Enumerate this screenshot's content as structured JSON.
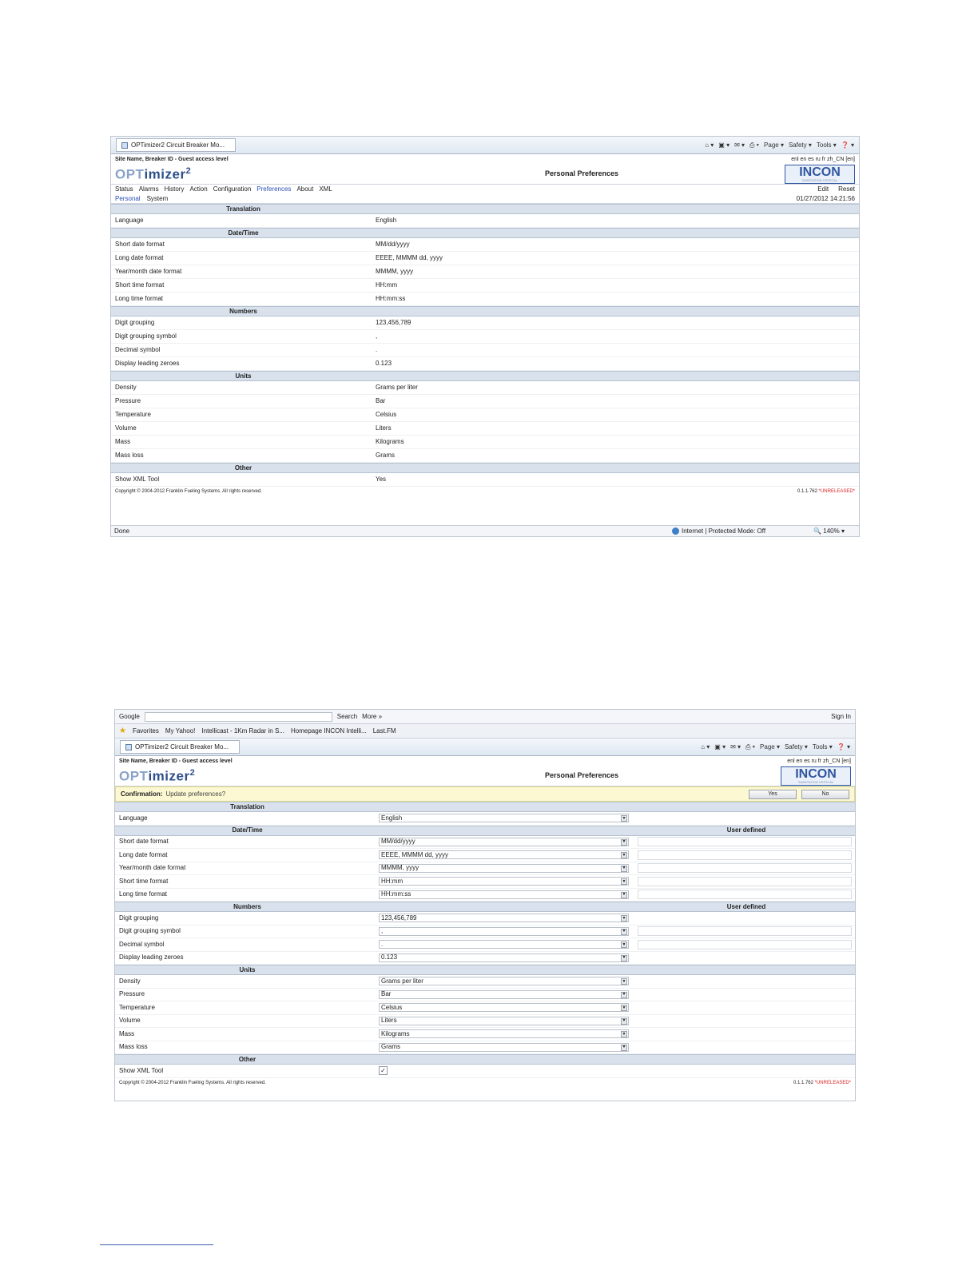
{
  "shot1": {
    "browser": {
      "tab_title": "OPTimizer2 Circuit Breaker Mo...",
      "commands": [
        "Page ▾",
        "Safety ▾",
        "Tools ▾",
        "❓ ▾"
      ]
    },
    "site_line": "Site Name, Breaker ID - Guest access level",
    "languages": "enl en es ru fr zh_CN [en]",
    "logo": {
      "light": "OPT",
      "dark": "imizer",
      "sup": "2"
    },
    "page_title": "Personal Preferences",
    "incon": {
      "brand": "INCON",
      "sub": "SUBSTATION CRITICAL"
    },
    "nav": [
      "Status",
      "Alarms",
      "History",
      "Action",
      "Configuration",
      "Preferences",
      "About",
      "XML"
    ],
    "nav_right": [
      "Edit",
      "Reset"
    ],
    "subnav": [
      "Personal",
      "System"
    ],
    "timestamp": "01/27/2012 14:21:56",
    "sections": {
      "translation": {
        "title": "Translation",
        "rows": [
          {
            "label": "Language",
            "value": "English"
          }
        ]
      },
      "datetime": {
        "title": "Date/Time",
        "rows": [
          {
            "label": "Short date format",
            "value": "MM/dd/yyyy"
          },
          {
            "label": "Long date format",
            "value": "EEEE, MMMM dd, yyyy"
          },
          {
            "label": "Year/month date format",
            "value": "MMMM, yyyy"
          },
          {
            "label": "Short time format",
            "value": "HH:mm"
          },
          {
            "label": "Long time format",
            "value": "HH:mm:ss"
          }
        ]
      },
      "numbers": {
        "title": "Numbers",
        "rows": [
          {
            "label": "Digit grouping",
            "value": "123,456,789"
          },
          {
            "label": "Digit grouping symbol",
            "value": ","
          },
          {
            "label": "Decimal symbol",
            "value": "."
          },
          {
            "label": "Display leading zeroes",
            "value": "0.123"
          }
        ]
      },
      "units": {
        "title": "Units",
        "rows": [
          {
            "label": "Density",
            "value": "Grams per liter"
          },
          {
            "label": "Pressure",
            "value": "Bar"
          },
          {
            "label": "Temperature",
            "value": "Celsius"
          },
          {
            "label": "Volume",
            "value": "Liters"
          },
          {
            "label": "Mass",
            "value": "Kilograms"
          },
          {
            "label": "Mass loss",
            "value": "Grams"
          }
        ]
      },
      "other": {
        "title": "Other",
        "rows": [
          {
            "label": "Show XML Tool",
            "value": "Yes"
          }
        ]
      }
    },
    "copyright": "Copyright © 2004-2012 Franklin Fueling Systems. All rights reserved.",
    "version": "0.1.1.762",
    "version_flag": "*UNRELEASED*",
    "status": {
      "left": "Done",
      "zone": "Internet | Protected Mode: Off",
      "zoom": "140%"
    }
  },
  "shot2": {
    "google": {
      "label": "Google",
      "search": "Search",
      "more": "More »",
      "signin": "Sign In"
    },
    "favorites": [
      "Favorites",
      "My Yahoo!",
      "Intellicast - 1Km Radar in S...",
      "Homepage INCON Intelli...",
      "Last.FM"
    ],
    "browser": {
      "tab_title": "OPTimizer2 Circuit Breaker Mo...",
      "commands": [
        "Page ▾",
        "Safety ▾",
        "Tools ▾",
        "❓ ▾"
      ]
    },
    "site_line": "Site Name, Breaker ID - Guest access level",
    "languages": "enl en es ru fr zh_CN [en]",
    "page_title": "Personal Preferences",
    "confirmation": {
      "label": "Confirmation:",
      "message": "Update preferences?",
      "yes": "Yes",
      "no": "No"
    },
    "user_defined": "User defined",
    "checkbox_mark": "✓",
    "sections": {
      "translation": {
        "title": "Translation",
        "rows": [
          {
            "label": "Language",
            "value": "English"
          }
        ]
      },
      "datetime": {
        "title": "Date/Time",
        "rows": [
          {
            "label": "Short date format",
            "value": "MM/dd/yyyy"
          },
          {
            "label": "Long date format",
            "value": "EEEE, MMMM dd, yyyy"
          },
          {
            "label": "Year/month date format",
            "value": "MMMM, yyyy"
          },
          {
            "label": "Short time format",
            "value": "HH:mm"
          },
          {
            "label": "Long time format",
            "value": "HH:mm:ss"
          }
        ]
      },
      "numbers": {
        "title": "Numbers",
        "rows": [
          {
            "label": "Digit grouping",
            "value": "123,456,789"
          },
          {
            "label": "Digit grouping symbol",
            "value": ","
          },
          {
            "label": "Decimal symbol",
            "value": "."
          },
          {
            "label": "Display leading zeroes",
            "value": "0.123"
          }
        ]
      },
      "units": {
        "title": "Units",
        "rows": [
          {
            "label": "Density",
            "value": "Grams per liter"
          },
          {
            "label": "Pressure",
            "value": "Bar"
          },
          {
            "label": "Temperature",
            "value": "Celsius"
          },
          {
            "label": "Volume",
            "value": "Liters"
          },
          {
            "label": "Mass",
            "value": "Kilograms"
          },
          {
            "label": "Mass loss",
            "value": "Grams"
          }
        ]
      },
      "other": {
        "title": "Other",
        "rows": [
          {
            "label": "Show XML Tool",
            "value": "checked"
          }
        ]
      }
    },
    "copyright": "Copyright © 2004-2012 Franklin Fueling Systems. All rights reserved.",
    "version": "0.1.1.762",
    "version_flag": "*UNRELEASED*"
  }
}
